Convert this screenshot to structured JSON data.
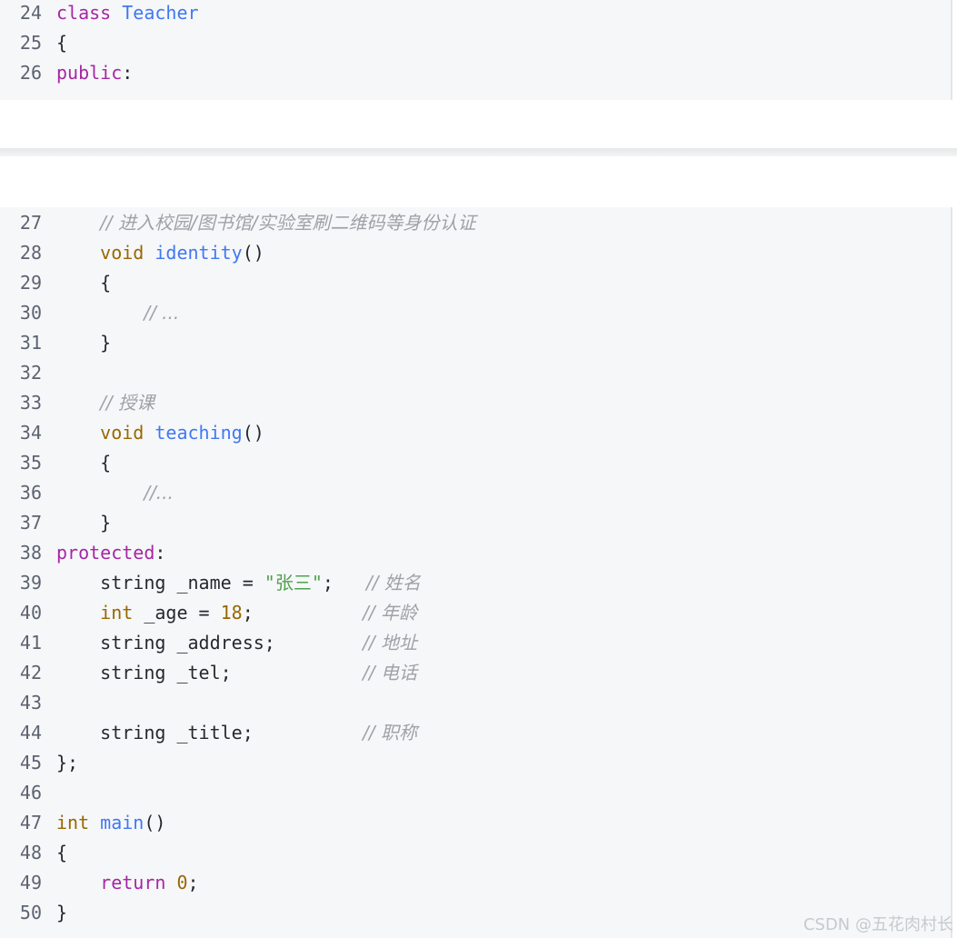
{
  "top_lines": [
    {
      "n": "24",
      "tokens": [
        {
          "t": "class",
          "c": "kw"
        },
        {
          "t": " ",
          "c": ""
        },
        {
          "t": "Teacher",
          "c": "cls"
        }
      ]
    },
    {
      "n": "25",
      "tokens": [
        {
          "t": "{",
          "c": ""
        }
      ]
    },
    {
      "n": "26",
      "tokens": [
        {
          "t": "public",
          "c": "kw"
        },
        {
          "t": ":",
          "c": ""
        }
      ]
    }
  ],
  "bottom_lines": [
    {
      "n": "27",
      "tokens": [
        {
          "t": "    ",
          "c": ""
        },
        {
          "t": "// 进入校园/图书馆/实验室刷二维码等身份认证",
          "c": "cm"
        }
      ]
    },
    {
      "n": "28",
      "tokens": [
        {
          "t": "    ",
          "c": ""
        },
        {
          "t": "void",
          "c": "ty"
        },
        {
          "t": " ",
          "c": ""
        },
        {
          "t": "identity",
          "c": "fn"
        },
        {
          "t": "()",
          "c": ""
        }
      ]
    },
    {
      "n": "29",
      "tokens": [
        {
          "t": "    {",
          "c": ""
        }
      ]
    },
    {
      "n": "30",
      "tokens": [
        {
          "t": "        ",
          "c": ""
        },
        {
          "t": "// ...",
          "c": "cm"
        }
      ]
    },
    {
      "n": "31",
      "tokens": [
        {
          "t": "    }",
          "c": ""
        }
      ]
    },
    {
      "n": "32",
      "tokens": []
    },
    {
      "n": "33",
      "tokens": [
        {
          "t": "    ",
          "c": ""
        },
        {
          "t": "// 授课",
          "c": "cm"
        }
      ]
    },
    {
      "n": "34",
      "tokens": [
        {
          "t": "    ",
          "c": ""
        },
        {
          "t": "void",
          "c": "ty"
        },
        {
          "t": " ",
          "c": ""
        },
        {
          "t": "teaching",
          "c": "fn"
        },
        {
          "t": "()",
          "c": ""
        }
      ]
    },
    {
      "n": "35",
      "tokens": [
        {
          "t": "    {",
          "c": ""
        }
      ]
    },
    {
      "n": "36",
      "tokens": [
        {
          "t": "        ",
          "c": ""
        },
        {
          "t": "//...",
          "c": "cm"
        }
      ]
    },
    {
      "n": "37",
      "tokens": [
        {
          "t": "    }",
          "c": ""
        }
      ]
    },
    {
      "n": "38",
      "tokens": [
        {
          "t": "protected",
          "c": "kw"
        },
        {
          "t": ":",
          "c": ""
        }
      ]
    },
    {
      "n": "39",
      "tokens": [
        {
          "t": "    string _name = ",
          "c": ""
        },
        {
          "t": "\"张三\"",
          "c": "str"
        },
        {
          "t": ";   ",
          "c": ""
        },
        {
          "t": "// 姓名",
          "c": "cm"
        }
      ]
    },
    {
      "n": "40",
      "tokens": [
        {
          "t": "    ",
          "c": ""
        },
        {
          "t": "int",
          "c": "ty"
        },
        {
          "t": " _age = ",
          "c": ""
        },
        {
          "t": "18",
          "c": "num"
        },
        {
          "t": ";          ",
          "c": ""
        },
        {
          "t": "// 年龄",
          "c": "cm"
        }
      ]
    },
    {
      "n": "41",
      "tokens": [
        {
          "t": "    string _address;        ",
          "c": ""
        },
        {
          "t": "// 地址",
          "c": "cm"
        }
      ]
    },
    {
      "n": "42",
      "tokens": [
        {
          "t": "    string _tel;            ",
          "c": ""
        },
        {
          "t": "// 电话",
          "c": "cm"
        }
      ]
    },
    {
      "n": "43",
      "tokens": []
    },
    {
      "n": "44",
      "tokens": [
        {
          "t": "    string _title;          ",
          "c": ""
        },
        {
          "t": "// 职称",
          "c": "cm"
        }
      ]
    },
    {
      "n": "45",
      "tokens": [
        {
          "t": "};",
          "c": ""
        }
      ]
    },
    {
      "n": "46",
      "tokens": []
    },
    {
      "n": "47",
      "tokens": [
        {
          "t": "int",
          "c": "ty"
        },
        {
          "t": " ",
          "c": ""
        },
        {
          "t": "main",
          "c": "fn"
        },
        {
          "t": "()",
          "c": ""
        }
      ]
    },
    {
      "n": "48",
      "tokens": [
        {
          "t": "{",
          "c": ""
        }
      ]
    },
    {
      "n": "49",
      "tokens": [
        {
          "t": "    ",
          "c": ""
        },
        {
          "t": "return",
          "c": "kw"
        },
        {
          "t": " ",
          "c": ""
        },
        {
          "t": "0",
          "c": "num"
        },
        {
          "t": ";",
          "c": ""
        }
      ]
    },
    {
      "n": "50",
      "tokens": [
        {
          "t": "}",
          "c": ""
        }
      ]
    }
  ],
  "watermark": "CSDN @五花肉村长"
}
